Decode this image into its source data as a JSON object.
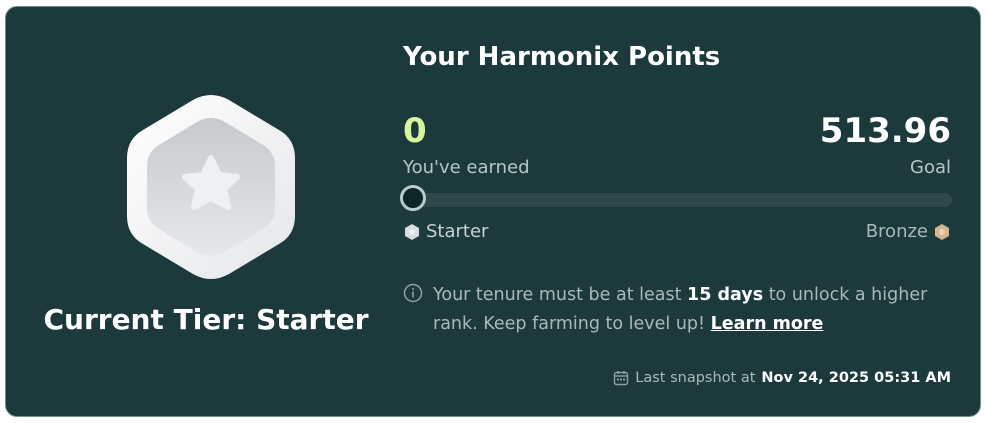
{
  "badge": {
    "icon": "star-hexagon-badge-icon",
    "tier_title": "Current Tier: Starter"
  },
  "points": {
    "title": "Your Harmonix Points",
    "earned_value": "0",
    "earned_label": "You've earned",
    "goal_value": "513.96",
    "goal_label": "Goal",
    "progress_fraction": 0,
    "current_tier_label": "Starter",
    "next_tier_label": "Bronze"
  },
  "notice": {
    "text_before": "Your tenure must be at least ",
    "days": "15 days",
    "text_after": " to unlock a higher rank. Keep farming to level up! ",
    "link_label": "Learn more"
  },
  "snapshot": {
    "label": "Last snapshot at",
    "timestamp": "Nov 24, 2025 05:31 AM"
  },
  "colors": {
    "card_bg": "#1c3a3b",
    "accent": "#d8f59a",
    "bronze": "#d8b48c",
    "silver": "#d9dcdf"
  }
}
